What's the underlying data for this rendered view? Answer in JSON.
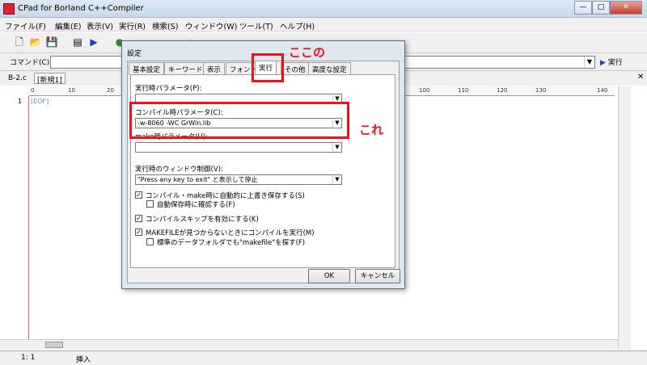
{
  "window": {
    "title": "CPad for Borland C++Compiler",
    "min": "—",
    "max": "□",
    "close": "✕"
  },
  "menu": [
    "ファイル(F)",
    "編集(E)",
    "表示(V)",
    "実行(R)",
    "検索(S)",
    "ウィンドウ(W)",
    "ツール(T)",
    "ヘルプ(H)"
  ],
  "command": {
    "label": "コマンド(C)",
    "run": "実行"
  },
  "doc_tabs": {
    "file": "B-2.c",
    "new_tab": "[新規1]"
  },
  "ruler": [
    "0",
    "10",
    "20",
    "30",
    "40",
    "50",
    "60",
    "70",
    "80",
    "90",
    "100",
    "110",
    "120",
    "130",
    "140"
  ],
  "editor": {
    "line_number": "1",
    "eof": "[EOF]"
  },
  "status": {
    "position": "1:  1",
    "mode": "挿入"
  },
  "dialog": {
    "title": "設定",
    "tabs": [
      "基本設定",
      "キーワード",
      "表示",
      "フォント",
      "実行",
      "その他",
      "高度な設定"
    ],
    "active_tab": "実行",
    "run_params_label": "実行時パラメータ(P):",
    "run_params_value": "",
    "compile_params_label": "コンパイル時パラメータ(C):",
    "compile_params_value": "-w-8060 -WC GrWin.lib",
    "make_params_label": "make時パラメータ(U):",
    "make_params_value": "",
    "window_ctrl_label": "実行時のウィンドウ制御(V):",
    "window_ctrl_value": "\"Press any key to exit\" と表示して停止",
    "opt_autosave": "コンパイル・make時に自動的に上書き保存する(S)",
    "opt_confirm": "自動保存時に確認する(F)",
    "opt_skip": "コンパイルスキップを有効にする(K)",
    "opt_makefile": "MAKEFILEが見つからないときにコンパイルを実行(M)",
    "opt_search_std": "標準のデータフォルダでも\"makefile\"を探す(F)",
    "ok": "OK",
    "cancel": "キャンセル"
  },
  "annotations": {
    "tab_note": "ここの",
    "param_note": "これ",
    "color": "#e8141c"
  }
}
